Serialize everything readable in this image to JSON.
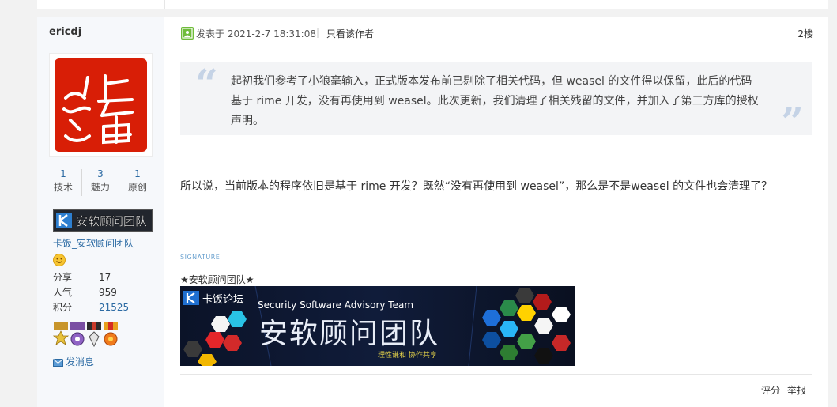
{
  "user": {
    "name": "ericdj",
    "avatar_text": "长善",
    "stats": [
      {
        "value": "1",
        "label": "技术"
      },
      {
        "value": "3",
        "label": "魅力"
      },
      {
        "value": "1",
        "label": "原创"
      }
    ],
    "badge_text": "安软顾问团队",
    "group_link": "卡饭_安软顾问团队",
    "info": [
      {
        "key": "分享",
        "value": "17"
      },
      {
        "key": "人气",
        "value": "959"
      },
      {
        "key": "积分",
        "value": "21525"
      }
    ],
    "pm_label": "发消息"
  },
  "post": {
    "posted_at": "发表于 2021-2-7 18:31:08",
    "separator": "|",
    "only_author": "只看该作者",
    "floor": "2楼",
    "quote": "起初我们参考了小狼毫输入，正式版本发布前已剔除了相关代码，但 weasel 的文件得以保留，此后的代码基于 rime 开发，没有再使用到 weasel。此次更新，我们清理了相关残留的文件，并加入了第三方库的授权声明。",
    "body": "所以说，当前版本的程序依旧是基于 rime 开发？既然“没有再使用到 weasel”，那么是不是weasel 的文件也会清理了？",
    "signature_label": "SIGNATURE",
    "signature_team": "★安软顾问团队★",
    "banner": {
      "brand": "卡饭论坛",
      "english": "Security Software Advisory Team",
      "chinese": "安软顾问团队",
      "slogan": "理性谦和  协作共享"
    },
    "actions": {
      "rate": "评分",
      "report": "举报"
    }
  },
  "colors": {
    "link": "#2b6aa3",
    "seal_red": "#d81e06",
    "sidebar_bg": "#f6f8fb"
  }
}
